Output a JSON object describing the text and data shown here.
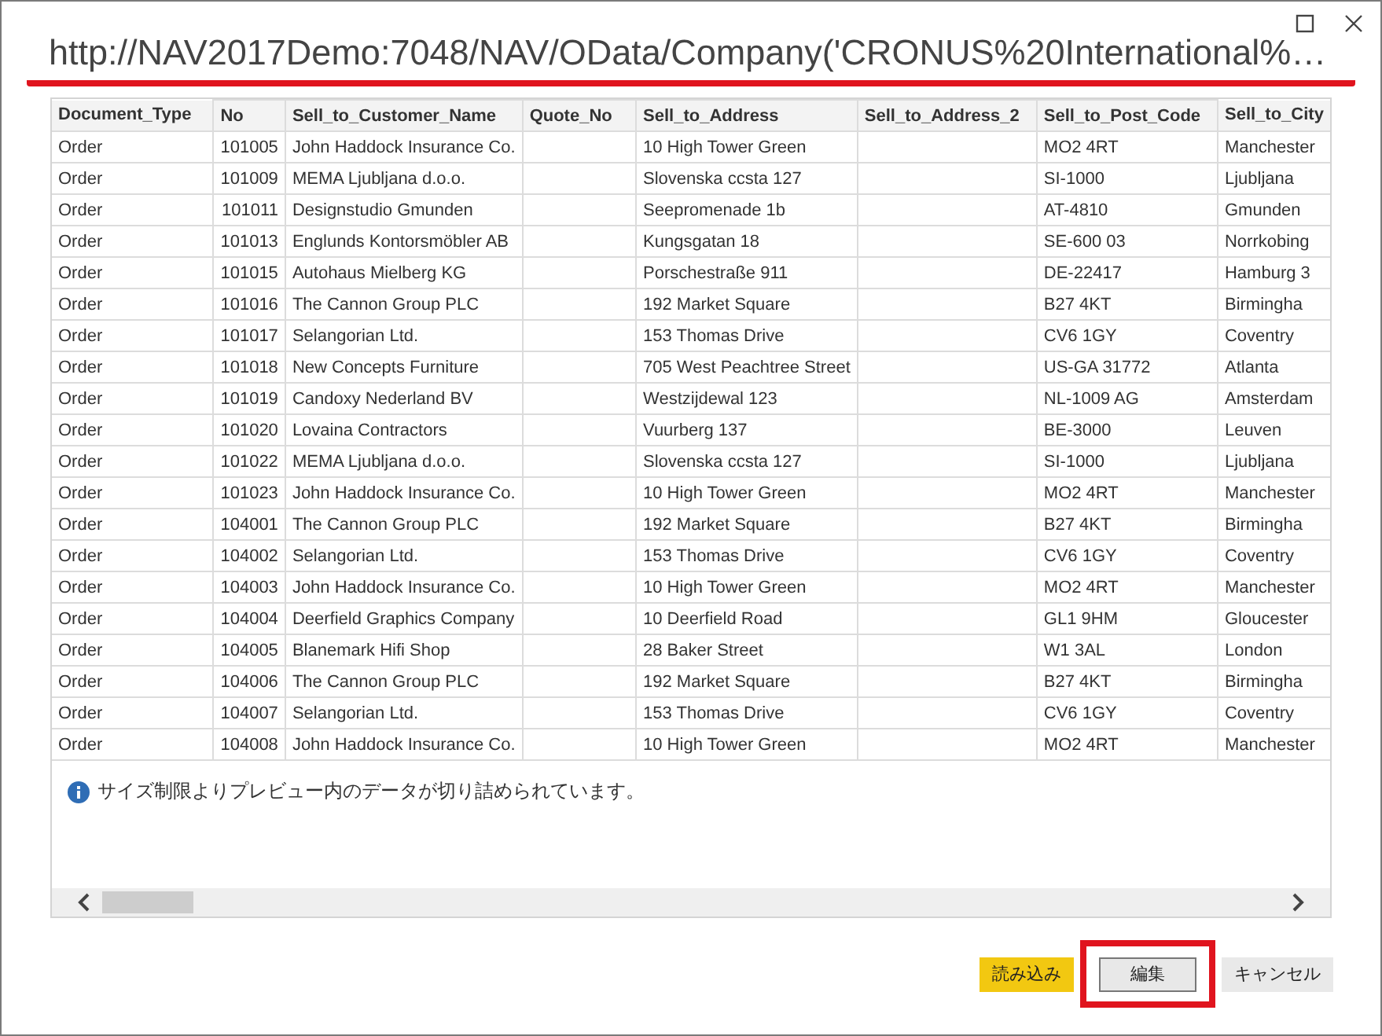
{
  "window": {
    "title": "http://NAV2017Demo:7048/NAV/OData/Company('CRONUS%20International%…",
    "title_underlined": true
  },
  "table": {
    "columns": [
      "Document_Type",
      "No",
      "Sell_to_Customer_Name",
      "Quote_No",
      "Sell_to_Address",
      "Sell_to_Address_2",
      "Sell_to_Post_Code",
      "Sell_to_City"
    ],
    "rows": [
      [
        "Order",
        "101005",
        "John Haddock Insurance Co.",
        null,
        "10 High Tower Green",
        null,
        "MO2 4RT",
        "Manchester"
      ],
      [
        "Order",
        "101009",
        "MEMA Ljubljana d.o.o.",
        null,
        "Slovenska ccsta 127",
        null,
        "SI-1000",
        "Ljubljana"
      ],
      [
        "Order",
        "101011",
        "Designstudio Gmunden",
        null,
        "Seepromenade 1b",
        null,
        "AT-4810",
        "Gmunden"
      ],
      [
        "Order",
        "101013",
        "Englunds Kontorsmöbler AB",
        null,
        "Kungsgatan 18",
        null,
        "SE-600 03",
        "Norrkobing"
      ],
      [
        "Order",
        "101015",
        "Autohaus Mielberg KG",
        null,
        "Porschestraße 911",
        null,
        "DE-22417",
        "Hamburg 3"
      ],
      [
        "Order",
        "101016",
        "The Cannon Group PLC",
        null,
        "192 Market Square",
        null,
        "B27 4KT",
        "Birmingha"
      ],
      [
        "Order",
        "101017",
        "Selangorian Ltd.",
        null,
        "153 Thomas Drive",
        null,
        "CV6 1GY",
        "Coventry"
      ],
      [
        "Order",
        "101018",
        "New Concepts Furniture",
        null,
        "705 West Peachtree Street",
        null,
        "US-GA 31772",
        "Atlanta"
      ],
      [
        "Order",
        "101019",
        "Candoxy Nederland BV",
        null,
        "Westzijdewal 123",
        null,
        "NL-1009 AG",
        "Amsterdam"
      ],
      [
        "Order",
        "101020",
        "Lovaina Contractors",
        null,
        "Vuurberg 137",
        null,
        "BE-3000",
        "Leuven"
      ],
      [
        "Order",
        "101022",
        "MEMA Ljubljana d.o.o.",
        null,
        "Slovenska ccsta 127",
        null,
        "SI-1000",
        "Ljubljana"
      ],
      [
        "Order",
        "101023",
        "John Haddock Insurance Co.",
        null,
        "10 High Tower Green",
        null,
        "MO2 4RT",
        "Manchester"
      ],
      [
        "Order",
        "104001",
        "The Cannon Group PLC",
        null,
        "192 Market Square",
        null,
        "B27 4KT",
        "Birmingha"
      ],
      [
        "Order",
        "104002",
        "Selangorian Ltd.",
        null,
        "153 Thomas Drive",
        null,
        "CV6 1GY",
        "Coventry"
      ],
      [
        "Order",
        "104003",
        "John Haddock Insurance Co.",
        null,
        "10 High Tower Green",
        null,
        "MO2 4RT",
        "Manchester"
      ],
      [
        "Order",
        "104004",
        "Deerfield Graphics Company",
        null,
        "10 Deerfield Road",
        null,
        "GL1 9HM",
        "Gloucester"
      ],
      [
        "Order",
        "104005",
        "Blanemark Hifi Shop",
        null,
        "28 Baker Street",
        null,
        "W1 3AL",
        "London"
      ],
      [
        "Order",
        "104006",
        "The Cannon Group PLC",
        null,
        "192 Market Square",
        null,
        "B27 4KT",
        "Birmingha"
      ],
      [
        "Order",
        "104007",
        "Selangorian Ltd.",
        null,
        "153 Thomas Drive",
        null,
        "CV6 1GY",
        "Coventry"
      ],
      [
        "Order",
        "104008",
        "John Haddock Insurance Co.",
        null,
        "10 High Tower Green",
        null,
        "MO2 4RT",
        "Manchester"
      ]
    ]
  },
  "notice": "サイズ制限よりプレビュー内のデータが切り詰められています。",
  "buttons": [
    {
      "label": "読み込み",
      "kind": "primary",
      "highlighted": false
    },
    {
      "label": "編集",
      "kind": "outlined",
      "highlighted": true
    },
    {
      "label": "キャンセル",
      "kind": "flat",
      "highlighted": false
    }
  ]
}
